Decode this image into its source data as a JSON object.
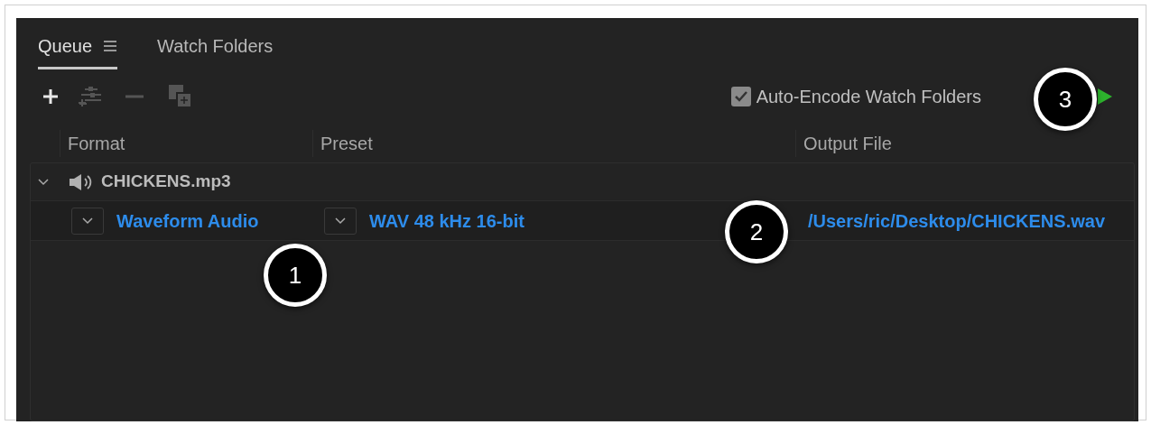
{
  "tabs": [
    {
      "label": "Queue",
      "selected": true,
      "has_menu": true
    },
    {
      "label": "Watch Folders",
      "selected": false,
      "has_menu": false
    }
  ],
  "toolbar": {
    "auto_encode": {
      "label": "Auto-Encode Watch Folders",
      "checked": true
    }
  },
  "table": {
    "columns": [
      "Format",
      "Preset",
      "Output File"
    ],
    "groups": [
      {
        "name": "CHICKENS.mp3",
        "expanded": true,
        "items": [
          {
            "format": "Waveform Audio",
            "preset": "WAV 48 kHz 16-bit",
            "output": "/Users/ric/Desktop/CHICKENS.wav"
          }
        ]
      }
    ]
  },
  "callouts": [
    {
      "label": "1"
    },
    {
      "label": "2"
    },
    {
      "label": "3"
    }
  ]
}
